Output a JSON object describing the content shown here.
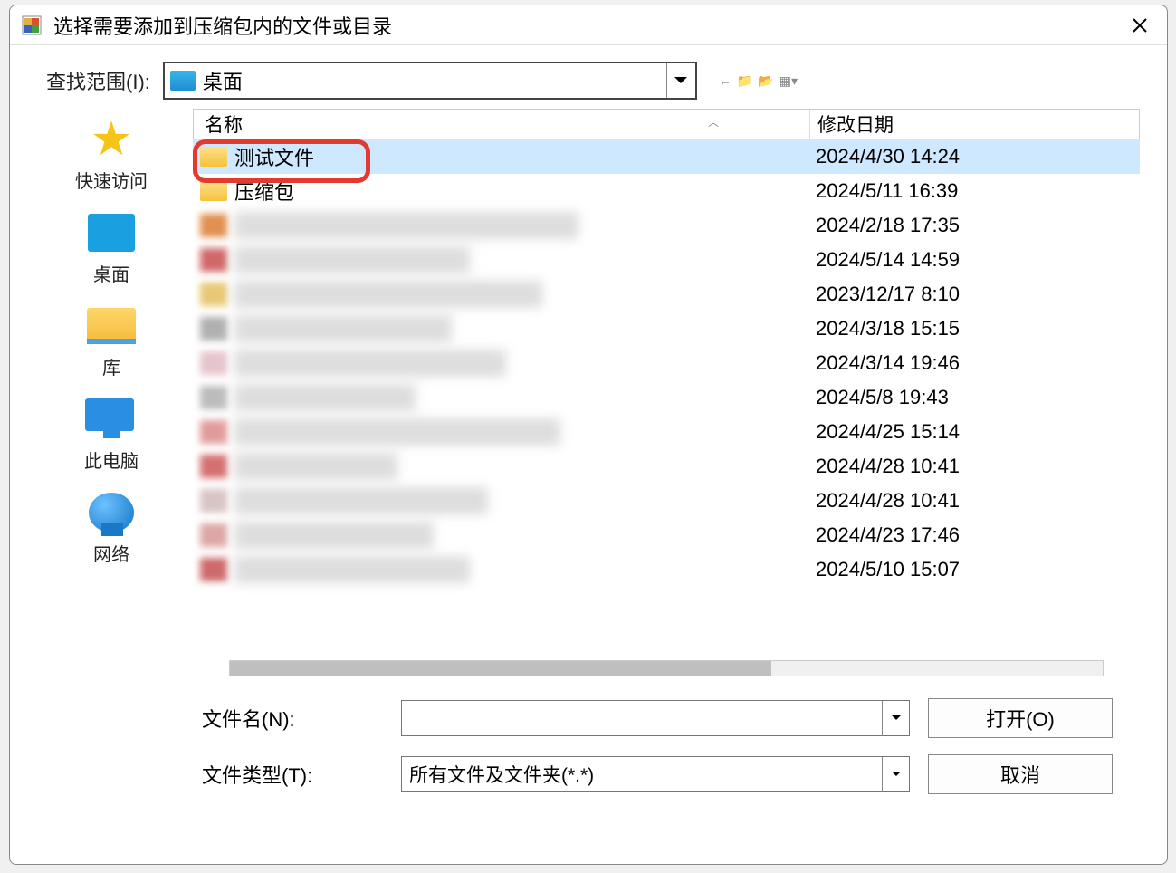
{
  "window": {
    "title": "选择需要添加到压缩包内的文件或目录"
  },
  "topbar": {
    "lookin_label": "查找范围(I):",
    "lookin_value": "桌面"
  },
  "sidebar": {
    "items": [
      {
        "label": "快速访问"
      },
      {
        "label": "桌面"
      },
      {
        "label": "库"
      },
      {
        "label": "此电脑"
      },
      {
        "label": "网络"
      }
    ]
  },
  "columns": {
    "name": "名称",
    "date": "修改日期"
  },
  "files": [
    {
      "name": "测试文件",
      "date": "2024/4/30 14:24",
      "selected": true,
      "folder": true,
      "blurred": false
    },
    {
      "name": "压缩包",
      "date": "2024/5/11 16:39",
      "selected": false,
      "folder": true,
      "blurred": false
    },
    {
      "name": "",
      "date": "2024/2/18 17:35",
      "selected": false,
      "folder": false,
      "blurred": true
    },
    {
      "name": "",
      "date": "2024/5/14 14:59",
      "selected": false,
      "folder": false,
      "blurred": true
    },
    {
      "name": "",
      "date": "2023/12/17 8:10",
      "selected": false,
      "folder": false,
      "blurred": true
    },
    {
      "name": "",
      "date": "2024/3/18 15:15",
      "selected": false,
      "folder": false,
      "blurred": true
    },
    {
      "name": "",
      "date": "2024/3/14 19:46",
      "selected": false,
      "folder": false,
      "blurred": true
    },
    {
      "name": "",
      "date": "2024/5/8 19:43",
      "selected": false,
      "folder": false,
      "blurred": true
    },
    {
      "name": "",
      "date": "2024/4/25 15:14",
      "selected": false,
      "folder": false,
      "blurred": true
    },
    {
      "name": "",
      "date": "2024/4/28 10:41",
      "selected": false,
      "folder": false,
      "blurred": true
    },
    {
      "name": "",
      "date": "2024/4/28 10:41",
      "selected": false,
      "folder": false,
      "blurred": true
    },
    {
      "name": "",
      "date": "2024/4/23 17:46",
      "selected": false,
      "folder": false,
      "blurred": true
    },
    {
      "name": "",
      "date": "2024/5/10 15:07",
      "selected": false,
      "folder": false,
      "blurred": true
    }
  ],
  "fields": {
    "filename_label": "文件名(N):",
    "filename_value": "",
    "filetype_label": "文件类型(T):",
    "filetype_value": "所有文件及文件夹(*.*)"
  },
  "buttons": {
    "open": "打开(O)",
    "cancel": "取消"
  },
  "blur_colors": [
    "#e09050",
    "#d06868",
    "#e8c874",
    "#b0b0b0",
    "#e6c4cc",
    "#bcbcbc",
    "#e29a9a",
    "#d47070",
    "#d8c4c4",
    "#dca6a6",
    "#cf6a6a"
  ]
}
